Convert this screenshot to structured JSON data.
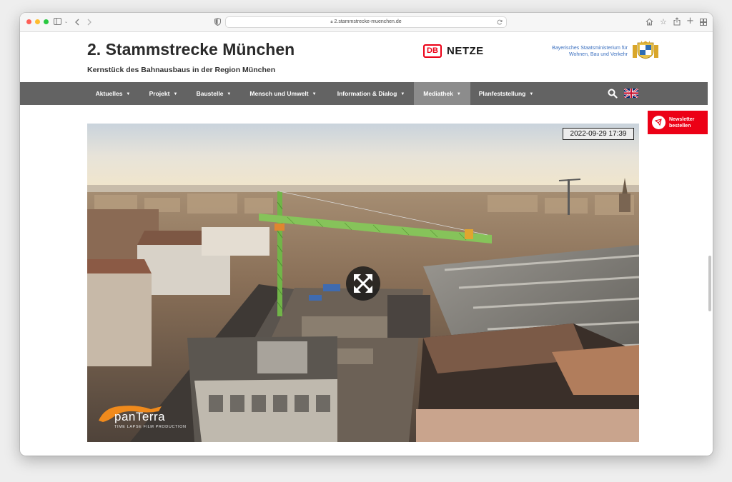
{
  "browser": {
    "url": "2.stammstrecke-muenchen.de",
    "icons": {
      "back": "chevron-left-icon",
      "forward": "chevron-right-icon",
      "sidebar": "sidebar-icon",
      "shield": "privacy-shield-icon",
      "lock": "lock-icon",
      "reload": "reload-icon",
      "home": "home-icon",
      "bookmark": "star-icon",
      "share": "share-icon",
      "new_tab": "plus-icon",
      "tabs": "tab-overview-icon"
    }
  },
  "header": {
    "title": "2. Stammstrecke München",
    "subtitle": "Kernstück des Bahnausbaus in der Region München",
    "db_logo": "DB",
    "db_brand": "NETZE",
    "ministry_line1": "Bayerisches Staatsministerium für",
    "ministry_line2": "Wohnen, Bau und Verkehr"
  },
  "nav": {
    "items": [
      {
        "label": "Aktuelles"
      },
      {
        "label": "Projekt"
      },
      {
        "label": "Baustelle"
      },
      {
        "label": "Mensch und Umwelt"
      },
      {
        "label": "Information & Dialog"
      },
      {
        "label": "Mediathek",
        "active": true
      },
      {
        "label": "Planfeststellung"
      }
    ],
    "search_icon": "search-icon",
    "language_icon": "uk-flag-icon"
  },
  "newsletter": {
    "label_line1": "Newsletter",
    "label_line2": "bestellen"
  },
  "video": {
    "timestamp": "2022-09-29 17:39",
    "expand_icon": "fullscreen-expand-icon",
    "brand_name": "panTerra",
    "brand_tagline": "TIME LAPSE FILM PRODUCTION"
  },
  "colors": {
    "nav_bg": "#636363",
    "nav_active": "#8c8c8c",
    "db_red": "#ec0016",
    "ministry_blue": "#3a6fbf"
  }
}
